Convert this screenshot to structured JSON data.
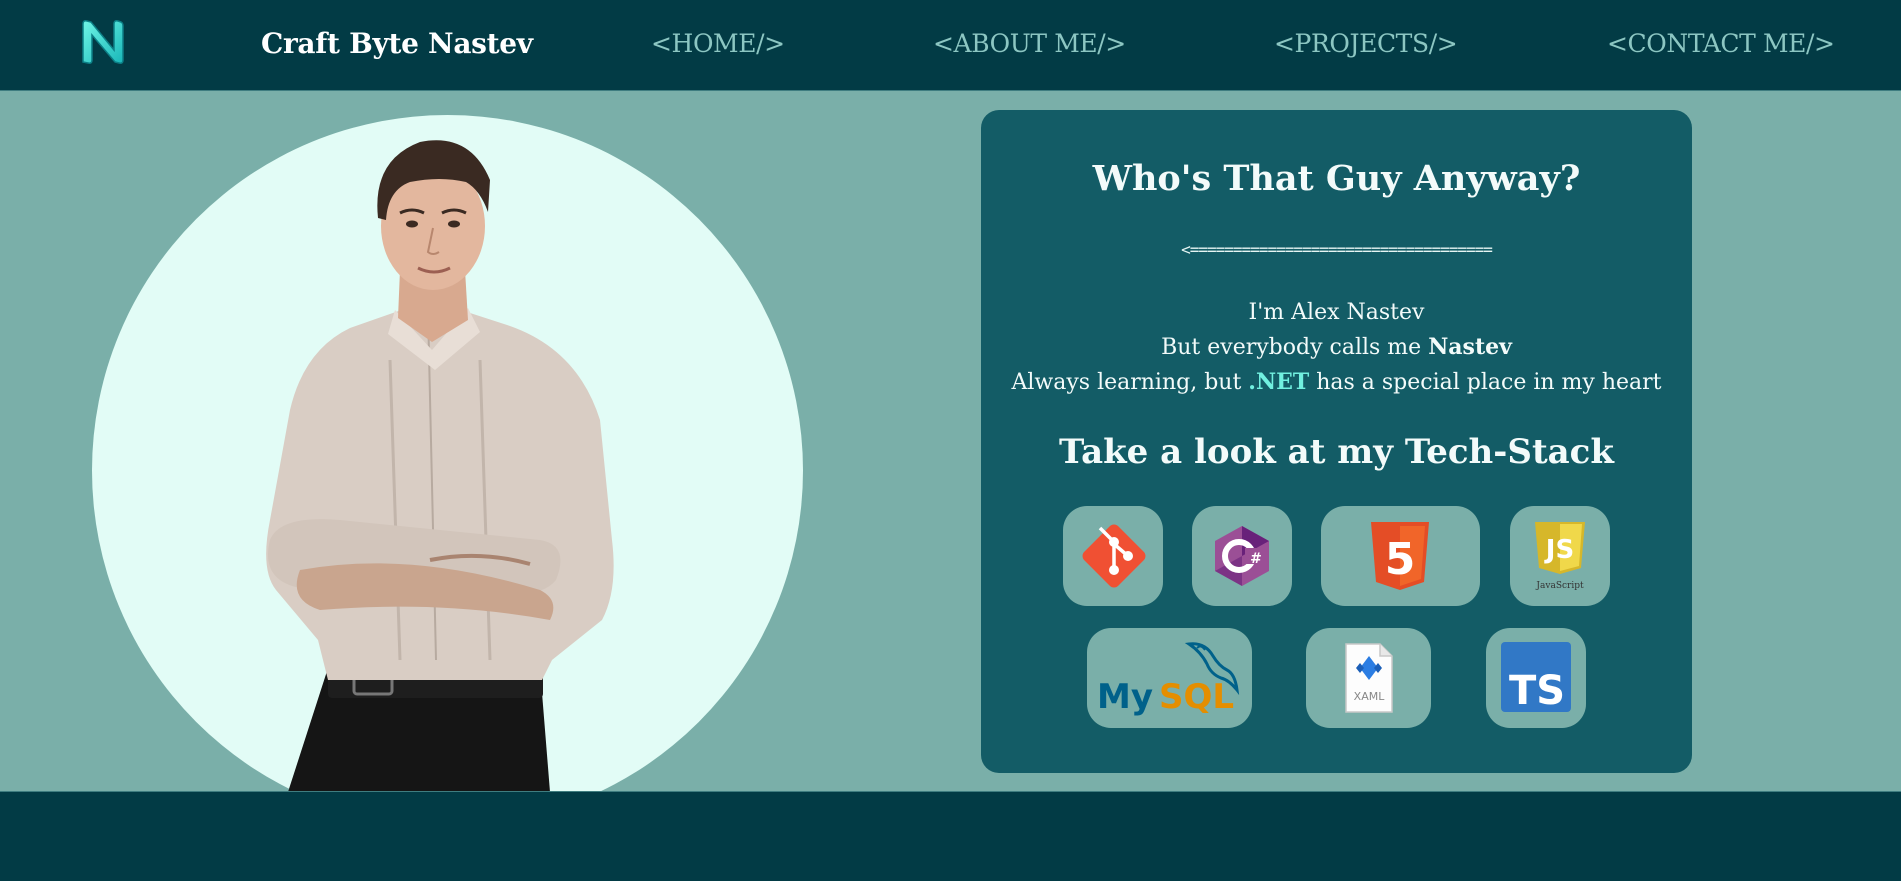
{
  "header": {
    "brand": "Craft Byte Nastev",
    "logo_icon": "n-logo-icon",
    "nav": [
      {
        "label": "<HOME/>"
      },
      {
        "label": "<ABOUT ME/>"
      },
      {
        "label": "<PROJECTS/>"
      },
      {
        "label": "<CONTACT ME/>"
      }
    ]
  },
  "about": {
    "title": "Who's That Guy Anyway?",
    "divider": "<===================================",
    "bio_line1": "I'm Alex Nastev",
    "bio_line2_prefix": "But everybody calls me ",
    "bio_line2_bold": "Nastev",
    "bio_line3_prefix": "Always learning, but ",
    "bio_line3_accent": ".NET",
    "bio_line3_suffix": " has a special place in my heart",
    "stack_title": "Take a look at my Tech-Stack"
  },
  "tech_stack": {
    "icons": [
      "git-icon",
      "csharp-icon",
      "html5-icon",
      "javascript-icon",
      "mysql-icon",
      "xaml-icon",
      "typescript-icon"
    ],
    "js_caption": "JavaScript",
    "mysql_text_a": "My",
    "mysql_text_b": "SQL",
    "xaml_text": "XAML",
    "ts_text": "TS",
    "html_text": "5",
    "js_text": "JS"
  },
  "colors": {
    "background": "#7aafa9",
    "header_footer": "#023b45",
    "card": "#135c66",
    "accent": "#71f0e0",
    "nav_text": "#8cc6c2"
  }
}
